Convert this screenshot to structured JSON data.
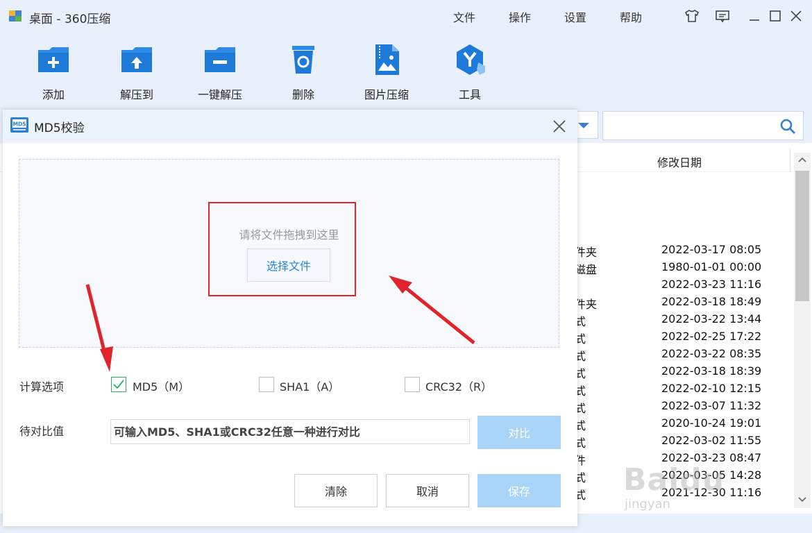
{
  "app": {
    "title": "桌面 - 360压缩"
  },
  "menu": [
    "文件",
    "操作",
    "设置",
    "帮助"
  ],
  "toolbar": {
    "items": [
      {
        "label": "添加",
        "icon": "add-folder-icon"
      },
      {
        "label": "解压到",
        "icon": "extract-to-icon"
      },
      {
        "label": "一键解压",
        "icon": "one-click-extract-icon"
      },
      {
        "label": "删除",
        "icon": "recycle-bin-icon"
      },
      {
        "label": "图片压缩",
        "icon": "image-compress-icon"
      },
      {
        "label": "工具",
        "icon": "tools-icon"
      }
    ]
  },
  "file_list": {
    "date_header": "修改日期",
    "rows": [
      {
        "type": "件夹",
        "date": "2022-03-17 08:05"
      },
      {
        "type": "磁盘",
        "date": "1980-01-01 00:00"
      },
      {
        "type": "",
        "date": "2022-03-23 11:16"
      },
      {
        "type": "件夹",
        "date": "2022-03-18 18:49"
      },
      {
        "type": "式",
        "date": "2022-03-22 13:44"
      },
      {
        "type": "式",
        "date": "2022-02-25 17:22"
      },
      {
        "type": "式",
        "date": "2022-03-22 08:35"
      },
      {
        "type": "式",
        "date": "2022-03-18 18:39"
      },
      {
        "type": "式",
        "date": "2022-02-10 12:15"
      },
      {
        "type": "式",
        "date": "2022-03-07 11:32"
      },
      {
        "type": "式",
        "date": "2020-10-24 19:01"
      },
      {
        "type": "式",
        "date": "2022-03-02 11:55"
      },
      {
        "type": "件",
        "date": "2022-03-23 08:47"
      },
      {
        "type": "式",
        "date": "2020-03-05 14:28"
      },
      {
        "type": "式",
        "date": "2021-12-30 11:16"
      }
    ]
  },
  "dialog": {
    "title": "MD5校验",
    "logo_text": "MD5",
    "drop_hint": "请将文件拖拽到这里",
    "choose_file": "选择文件",
    "calc_label": "计算选项",
    "options": [
      {
        "label": "MD5（M）",
        "checked": true
      },
      {
        "label": "SHA1（A）",
        "checked": false
      },
      {
        "label": "CRC32（R）",
        "checked": false
      }
    ],
    "compare_label": "待对比值",
    "compare_placeholder": "可输入MD5、SHA1或CRC32任意一种进行对比",
    "compare_button": "对比",
    "clear_button": "清除",
    "cancel_button": "取消",
    "save_button": "保存"
  },
  "watermark": {
    "text": "Baidu",
    "sub": "jingyan"
  },
  "colors": {
    "accent": "#2b86d8",
    "highlight": "#e0242b",
    "disabled_button": "#a7d4f7",
    "check": "#2bb06a"
  }
}
